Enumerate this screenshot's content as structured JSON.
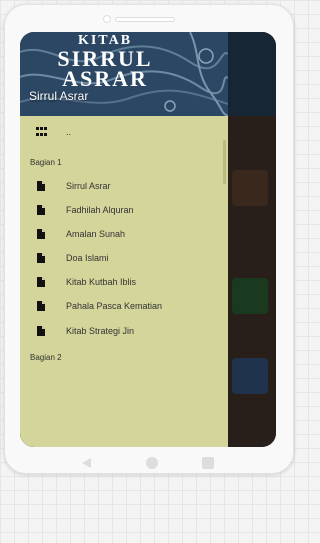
{
  "drawer": {
    "header_book_title": [
      "KITAB",
      "SIRRUL",
      "ASRAR"
    ],
    "header_caption": "Sirrul Asrar",
    "top_item_label": "..",
    "sections": [
      {
        "label": "Bagian 1",
        "items": [
          "Sirrul Asrar",
          "Fadhilah Alquran",
          "Amalan Sunah",
          "Doa Islami",
          "Kitab Kutbah Iblis",
          "Pahala Pasca Kematian",
          "Kitab Strategi Jin"
        ]
      },
      {
        "label": "Bagian 2",
        "items": []
      }
    ]
  },
  "colors": {
    "drawer_bg": "#d3d59a",
    "header_bg": "#2c4764",
    "text": "#333333"
  },
  "icons": {
    "menu_top": "grid-icon",
    "menu_item": "document-icon"
  }
}
